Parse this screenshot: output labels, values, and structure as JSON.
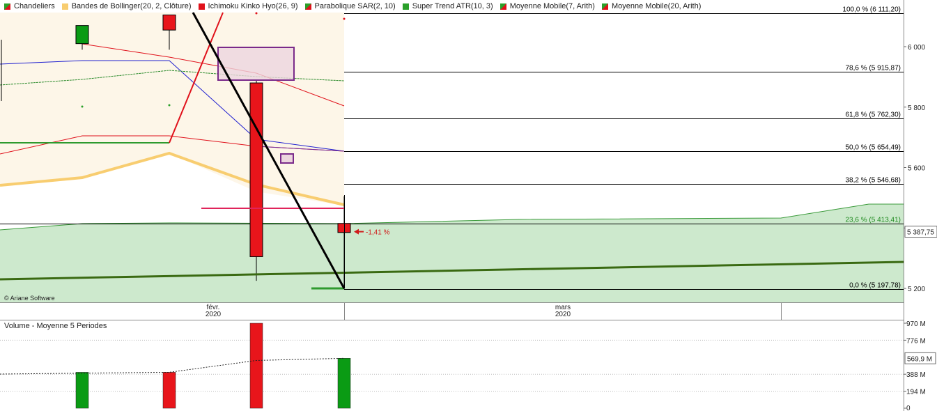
{
  "legend": [
    {
      "label": "Chandeliers",
      "swatch": [
        "#2aa02a",
        "#e0111b"
      ]
    },
    {
      "label": "Bandes de Bollinger(20, 2, Clôture)",
      "swatch": [
        "#f8cd70",
        "#f8cd70"
      ]
    },
    {
      "label": "Ichimoku Kinko Hyo(26, 9)",
      "swatch": [
        "#e0111b",
        "#e0111b"
      ]
    },
    {
      "label": "Parabolique SAR(2, 10)",
      "swatch": [
        "#2aa02a",
        "#e0111b"
      ]
    },
    {
      "label": "Super Trend ATR(10, 3)",
      "swatch": [
        "#2aa02a",
        "#2aa02a"
      ]
    },
    {
      "label": "Moyenne Mobile(7, Arith)",
      "swatch": [
        "#2aa02a",
        "#e0111b"
      ]
    },
    {
      "label": "Moyenne Mobile(20, Arith)",
      "swatch": [
        "#2aa02a",
        "#e0111b"
      ]
    }
  ],
  "credit": "© Ariane Software",
  "volume_legend": "Volume  - Moyenne 5 Periodes",
  "x_axis": [
    {
      "month": "févr.",
      "year": "2020"
    },
    {
      "month": "mars",
      "year": "2020"
    }
  ],
  "colors": {
    "up": "#0a9b14",
    "down": "#e8151b",
    "cloud": "#cde9cd",
    "bollinger": "#f8cd70",
    "bollinger_fill": "#fdf6e8",
    "supertrend": "#2e9a2e",
    "trendline": "#3a6a12",
    "fib": "#000000",
    "last_price": "#d01a1a"
  },
  "chart_data": {
    "type": "candlestick",
    "y_ticks": [
      5200,
      5400,
      5600,
      5800,
      6000
    ],
    "y_tick_labels": [
      "5 200",
      "5 400",
      "5 600",
      "5 800",
      "6 000"
    ],
    "last_price": {
      "value": 5387.75,
      "label": "5 387,75",
      "change_label": "-1,41 %"
    },
    "candles": [
      {
        "open": 6010,
        "high": 6025,
        "low": 5990,
        "close": 6070,
        "dir": "up"
      },
      {
        "open": 6055,
        "high": 6080,
        "low": 5990,
        "close": 6105,
        "dir": "down"
      },
      {
        "open": 5880,
        "high": 5890,
        "low": 5225,
        "close": 5305,
        "dir": "down"
      },
      {
        "open": 5415,
        "high": 5505,
        "low": 5198,
        "close": 5385,
        "dir": "down"
      }
    ],
    "fibonacci": [
      {
        "level": 100.0,
        "value": 6111.2,
        "label": "100,0 % (6 111,20)"
      },
      {
        "level": 78.6,
        "value": 5915.87,
        "label": "78,6 % (5 915,87)"
      },
      {
        "level": 61.8,
        "value": 5762.3,
        "label": "61,8 % (5 762,30)"
      },
      {
        "level": 50.0,
        "value": 5654.49,
        "label": "50,0 % (5 654,49)"
      },
      {
        "level": 38.2,
        "value": 5546.68,
        "label": "38,2 % (5 546,68)"
      },
      {
        "level": 23.6,
        "value": 5413.41,
        "label": "23,6 % (5 413,41)"
      },
      {
        "level": 0.0,
        "value": 5197.78,
        "label": "0,0 % (5 197,78)"
      }
    ],
    "volume": {
      "y_ticks": [
        0,
        194,
        388,
        776,
        970
      ],
      "y_tick_labels": [
        "0",
        "194 M",
        "388 M",
        "776 M",
        "970 M"
      ],
      "last_label": "569,9 M",
      "bars": [
        {
          "value": 410,
          "dir": "up"
        },
        {
          "value": 410,
          "dir": "down"
        },
        {
          "value": 970,
          "dir": "down"
        },
        {
          "value": 570,
          "dir": "up"
        }
      ],
      "average": [
        400,
        410,
        545,
        570
      ]
    }
  }
}
